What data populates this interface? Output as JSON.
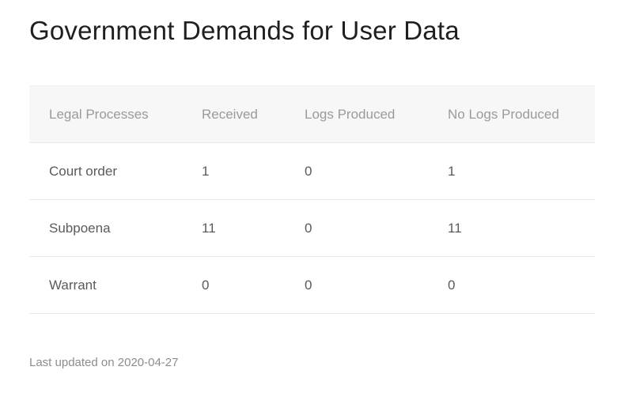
{
  "title": "Government Demands for User Data",
  "table": {
    "headers": [
      "Legal Processes",
      "Received",
      "Logs Produced",
      "No Logs Produced"
    ],
    "rows": [
      [
        "Court order",
        "1",
        "0",
        "1"
      ],
      [
        "Subpoena",
        "11",
        "0",
        "11"
      ],
      [
        "Warrant",
        "0",
        "0",
        "0"
      ]
    ]
  },
  "footer": {
    "last_updated": "Last updated on 2020-04-27"
  }
}
